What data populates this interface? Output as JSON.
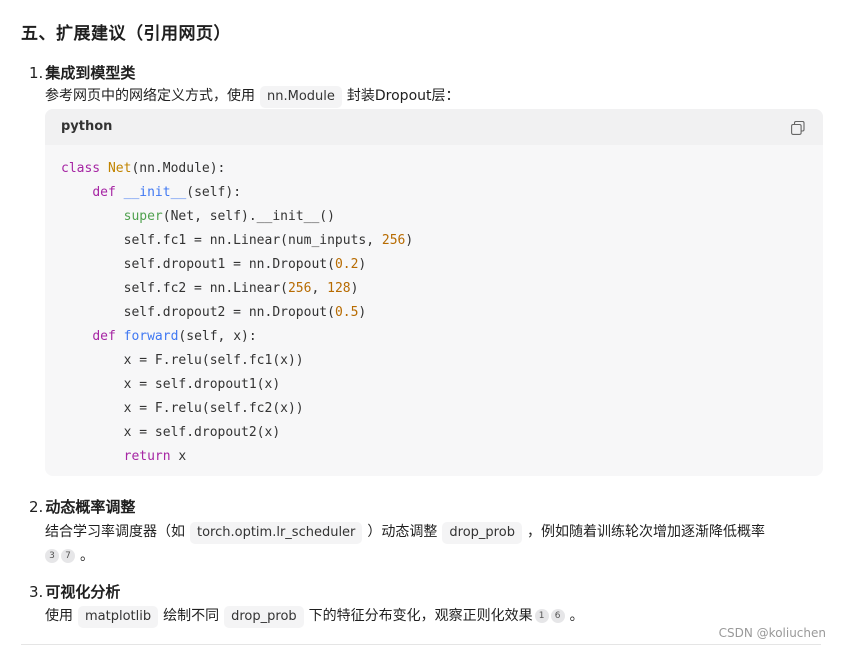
{
  "section_title": "五、扩展建议（引用网页）",
  "item1": {
    "num": "1.",
    "title": "集成到模型类",
    "desc_before": "参考网页中的网络定义方式，使用",
    "code": "nn.Module",
    "desc_after": "封装Dropout层："
  },
  "codeblock": {
    "language": "python",
    "copy_icon": "copy-icon"
  },
  "item2": {
    "num": "2.",
    "title": "动态概率调整",
    "desc_part1": "结合学习率调度器（如",
    "code1": "torch.optim.lr_scheduler",
    "desc_part2": "）动态调整",
    "code2": "drop_prob",
    "desc_part3": "，例如随着训练轮次增加逐渐降低概率",
    "cite1": "3",
    "cite2": "7",
    "tail": "。"
  },
  "item3": {
    "num": "3.",
    "title": "可视化分析",
    "desc_part1": "使用",
    "code1": "matplotlib",
    "desc_part2": "绘制不同",
    "code2": "drop_prob",
    "desc_part3": "下的特征分布变化，观察正则化效果",
    "cite1": "1",
    "cite2": "6",
    "tail": "。"
  },
  "watermark": "CSDN @koliuchen",
  "colors": {
    "keyword": "#a626a4",
    "class_name": "#c18401",
    "function_name": "#4078f2",
    "builtin": "#50a14f",
    "number": "#b76b01"
  }
}
